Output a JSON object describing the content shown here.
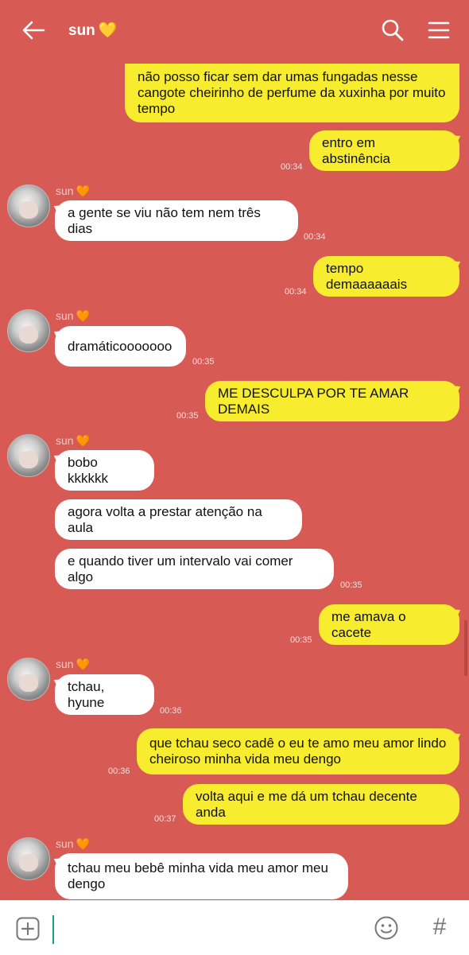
{
  "header": {
    "title": "sun",
    "title_emoji": "💛",
    "icons": [
      "back-arrow-icon",
      "search-icon",
      "menu-icon"
    ]
  },
  "contact": {
    "name": "sun",
    "heart": "🧡"
  },
  "messages": [
    {
      "dir": "out",
      "text": "não posso ficar sem dar umas fungadas nesse cangote cheirinho de perfume da xuxinha por muito tempo",
      "time": ""
    },
    {
      "dir": "out",
      "text": "entro em abstinência",
      "time": "00:34"
    },
    {
      "dir": "in",
      "text": "a gente se viu não tem nem três dias",
      "time": "00:34"
    },
    {
      "dir": "out",
      "text": "tempo demaaaaaais",
      "time": "00:34"
    },
    {
      "dir": "in",
      "text": "dramáticooooooo",
      "time": "00:35"
    },
    {
      "dir": "out",
      "text": "ME DESCULPA POR TE AMAR DEMAIS",
      "time": "00:35"
    },
    {
      "dir": "in",
      "text": "bobo kkkkkk",
      "time": ""
    },
    {
      "dir": "in",
      "text": "agora volta a prestar atenção na aula",
      "time": ""
    },
    {
      "dir": "in",
      "text": "e quando tiver um intervalo vai comer algo",
      "time": "00:35"
    },
    {
      "dir": "out",
      "text": "me amava o cacete",
      "time": "00:35"
    },
    {
      "dir": "in",
      "text": "tchau, hyune",
      "time": "00:36"
    },
    {
      "dir": "out",
      "text": "que tchau seco cadê o eu te amo meu amor lindo cheiroso minha vida meu dengo",
      "time": "00:36"
    },
    {
      "dir": "out",
      "text": "volta aqui e me dá um tchau decente anda",
      "time": "00:37"
    },
    {
      "dir": "in",
      "text": "tchau meu bebê minha vida meu amor meu dengo",
      "time": ""
    }
  ],
  "composer": {
    "value": "",
    "placeholder": "",
    "icons": [
      "plus-icon",
      "emoji-icon",
      "hashtag-icon"
    ],
    "hash_glyph": "#"
  },
  "colors": {
    "background": "#d85a55",
    "outgoing_bubble": "#f7ec2e",
    "incoming_bubble": "#ffffff",
    "cursor": "#19a08a"
  }
}
